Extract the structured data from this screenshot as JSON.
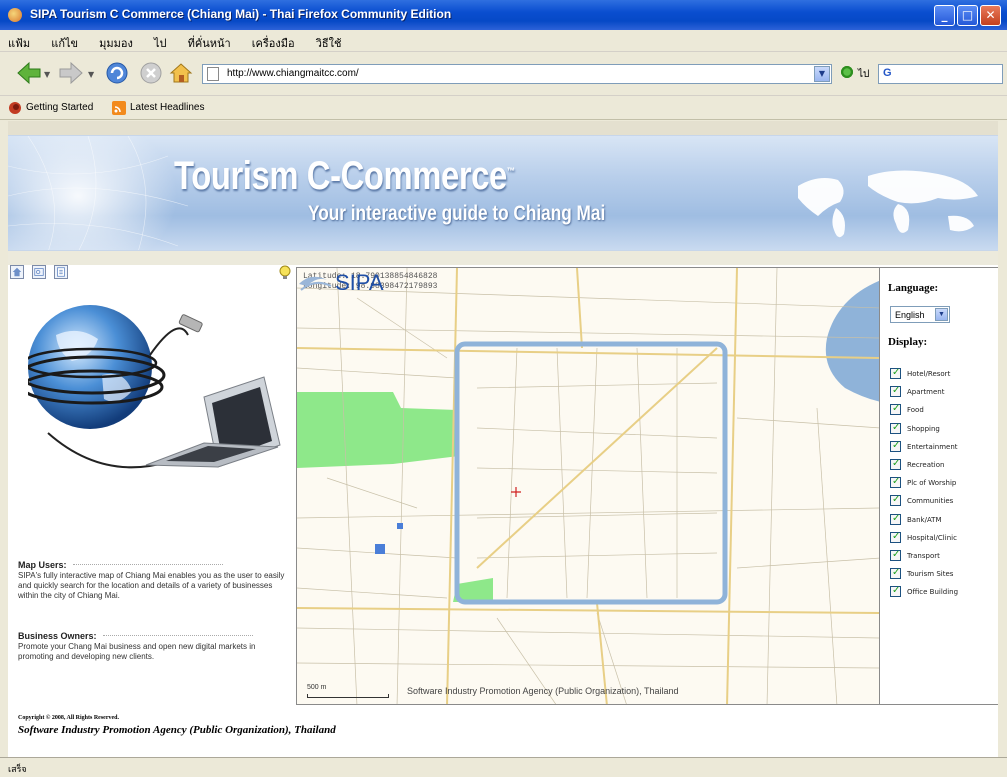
{
  "window": {
    "title": "SIPA Tourism C Commerce (Chiang Mai) - Thai Firefox Community Edition",
    "controls": [
      "minimize",
      "maximize",
      "close"
    ]
  },
  "menu": [
    "แฟ้ม",
    "แก้ไข",
    "มุมมอง",
    "ไป",
    "ที่คั่นหน้า",
    "เครื่องมือ",
    "วิธีใช้"
  ],
  "navbar": {
    "url": "http://www.chiangmaitcc.com/",
    "go_label": "ไป",
    "search_engine_icon": "G"
  },
  "bookmarks": [
    {
      "label": "Getting Started",
      "icon": "firefox-icon"
    },
    {
      "label": "Latest Headlines",
      "icon": "rss-icon"
    }
  ],
  "banner": {
    "title": "Tourism C-Commerce",
    "tm": "™",
    "subtitle": "Your interactive guide to Chiang Mai"
  },
  "map": {
    "latitude": "Latitude: 18.790138854846828",
    "longitude": "Longitude: 98.98398472179893",
    "scale_label": "500 m",
    "copyright": "Software Industry Promotion Agency (Public Organization), Thailand",
    "logo_text": "SIPA"
  },
  "left_info": {
    "users_head": "Map Users:",
    "users_body": "SIPA's fully interactive map of Chiang Mai enables you as the user to easily and quickly search for the location and details of a variety of businesses within the city of Chiang Mai.",
    "owners_head": "Business Owners:",
    "owners_body": "Promote your Chang Mai business and open new digital markets in promoting and developing new clients."
  },
  "right_panel": {
    "language_label": "Language:",
    "language_value": "English",
    "display_label": "Display:",
    "categories": [
      {
        "label": "Hotel/Resort",
        "checked": true
      },
      {
        "label": "Apartment",
        "checked": true
      },
      {
        "label": "Food",
        "checked": true
      },
      {
        "label": "Shopping",
        "checked": true
      },
      {
        "label": "Entertainment",
        "checked": true
      },
      {
        "label": "Recreation",
        "checked": true
      },
      {
        "label": "Plc of Worship",
        "checked": true
      },
      {
        "label": "Communities",
        "checked": true
      },
      {
        "label": "Bank/ATM",
        "checked": true
      },
      {
        "label": "Hospital/Clinic",
        "checked": true
      },
      {
        "label": "Transport",
        "checked": true
      },
      {
        "label": "Tourism Sites",
        "checked": true
      },
      {
        "label": "Office Building",
        "checked": true
      }
    ]
  },
  "footer": {
    "copyright": "Copyright © 2008, All Rights Reserved.",
    "org": "Software Industry Promotion Agency (Public Organization), Thailand"
  },
  "status": "เสร็จ",
  "colors": {
    "titlebar": "#0a4ed0",
    "moat": "#8fb3d9",
    "park": "#8ee88a",
    "river": "#8fb3d9"
  }
}
